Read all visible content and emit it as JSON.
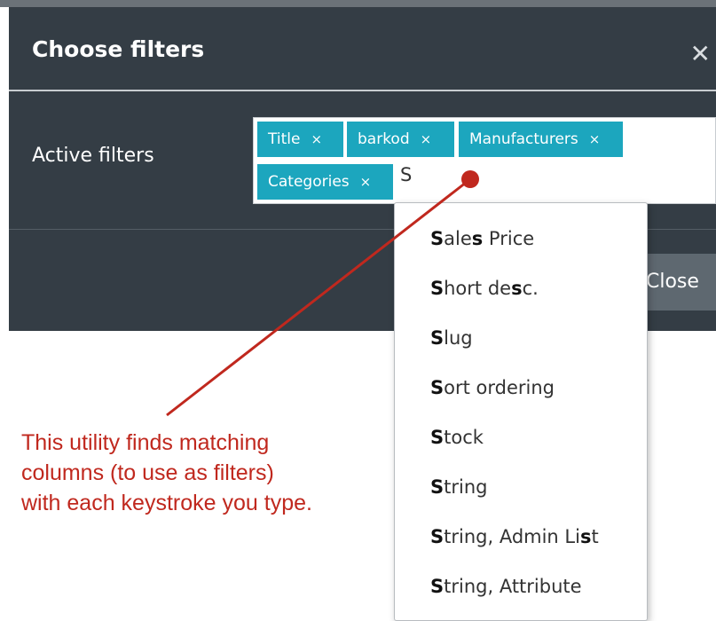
{
  "modal": {
    "title": "Choose filters",
    "close_icon": "close-icon",
    "active_filters_label": "Active filters",
    "tags": [
      {
        "label": "Title",
        "remove": "×"
      },
      {
        "label": "barkod",
        "remove": "×"
      },
      {
        "label": "Manufacturers",
        "remove": "×"
      },
      {
        "label": "Categories",
        "remove": "×"
      }
    ],
    "input_value": "S",
    "close_button": "Close"
  },
  "dropdown": {
    "items": [
      {
        "parts": [
          [
            "S",
            true
          ],
          [
            "ale",
            false
          ],
          [
            "s",
            true
          ],
          [
            " Price",
            false
          ]
        ]
      },
      {
        "parts": [
          [
            "S",
            true
          ],
          [
            "hort de",
            false
          ],
          [
            "s",
            true
          ],
          [
            "c.",
            false
          ]
        ]
      },
      {
        "parts": [
          [
            "S",
            true
          ],
          [
            "lug",
            false
          ]
        ]
      },
      {
        "parts": [
          [
            "S",
            true
          ],
          [
            "ort ordering",
            false
          ]
        ]
      },
      {
        "parts": [
          [
            "S",
            true
          ],
          [
            "tock",
            false
          ]
        ]
      },
      {
        "parts": [
          [
            "S",
            true
          ],
          [
            "tring",
            false
          ]
        ]
      },
      {
        "parts": [
          [
            "S",
            true
          ],
          [
            "tring, Admin Li",
            false
          ],
          [
            "s",
            true
          ],
          [
            "t",
            false
          ]
        ]
      },
      {
        "parts": [
          [
            "S",
            true
          ],
          [
            "tring, Attribute",
            false
          ]
        ]
      }
    ]
  },
  "annotation": {
    "line1": "This utility finds matching",
    "line2": "columns (to use as filters)",
    "line3": "with each keystroke you type.",
    "color": "#c0281e"
  },
  "colors": {
    "modal_bg": "#343d45",
    "tag_bg": "#1ca6be"
  }
}
